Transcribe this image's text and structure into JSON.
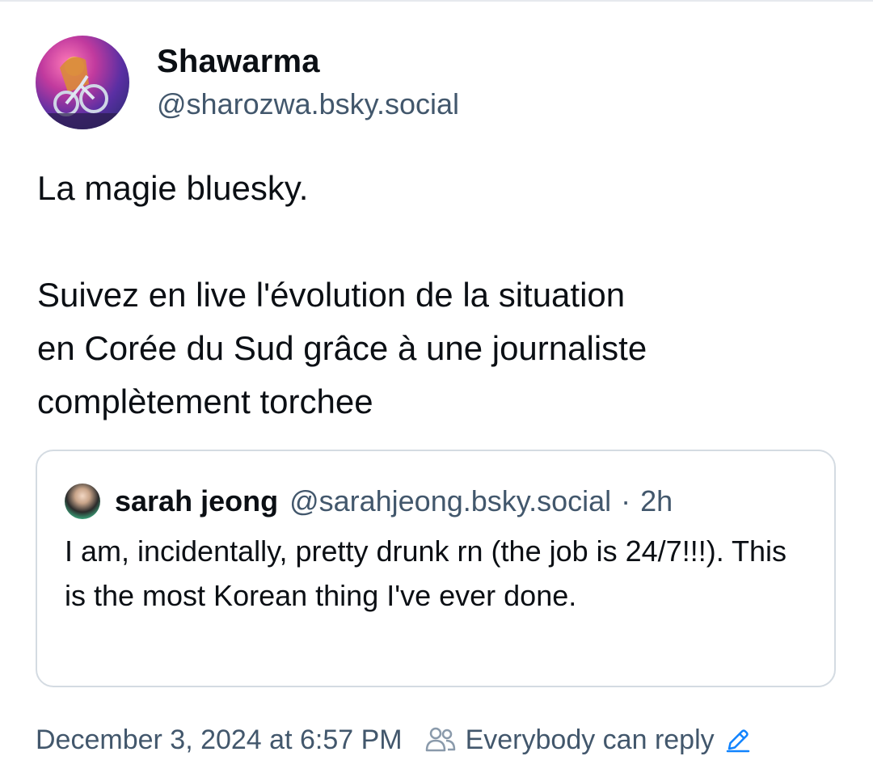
{
  "post": {
    "author": {
      "display_name": "Shawarma",
      "handle": "@sharozwa.bsky.social",
      "avatar_icon": "avatar-image"
    },
    "text": {
      "paragraph1": "La magie bluesky.",
      "paragraph2_line1": "Suivez en live l'évolution de la situation",
      "paragraph2_line2": "en Corée du Sud grâce à une journaliste",
      "paragraph2_line3": "complètement torchee"
    },
    "quote": {
      "author_name": "sarah jeong",
      "author_handle": "@sarahjeong.bsky.social",
      "separator": "·",
      "time": "2h",
      "text": "I am, incidentally, pretty drunk rn (the job is 24/7!!!). This is the most Korean thing I've ever done."
    },
    "meta": {
      "timestamp": "December 3, 2024 at 6:57 PM",
      "reply_setting": "Everybody can reply",
      "reply_icon": "people-icon",
      "edit_icon": "pencil-icon"
    }
  },
  "colors": {
    "text_primary": "#0b0f14",
    "text_secondary": "#42576c",
    "border": "#d4dbe2",
    "accent": "#1083fe"
  }
}
